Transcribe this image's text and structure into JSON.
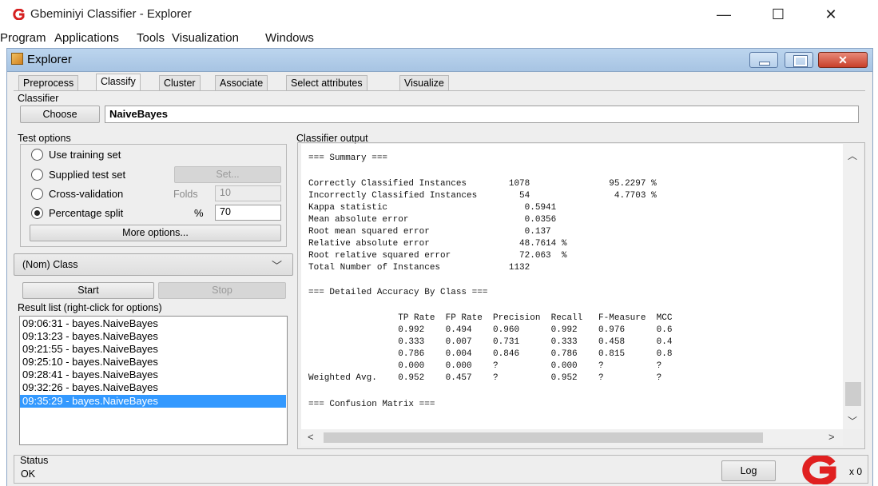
{
  "window": {
    "title": "Gbeminiyi Classifier - Explorer",
    "controls": {
      "minimize": "—",
      "maximize": "☐",
      "close": "✕"
    }
  },
  "menu": [
    "Program",
    "Applications",
    "Tools",
    "Visualization",
    "Windows"
  ],
  "inner": {
    "title": "Explorer"
  },
  "tabs": [
    "Preprocess",
    "Classify",
    "Cluster",
    "Associate",
    "Select attributes",
    "Visualize"
  ],
  "active_tab": "Classify",
  "classifier": {
    "group_label": "Classifier",
    "choose_label": "Choose",
    "value": "NaiveBayes"
  },
  "test_options": {
    "group_label": "Test options",
    "use_training": "Use training set",
    "supplied_test": "Supplied test set",
    "set_button": "Set...",
    "cross_validation": "Cross-validation",
    "folds_label": "Folds",
    "folds_value": "10",
    "percentage_split": "Percentage split",
    "percent_symbol": "%",
    "percent_value": "70",
    "selected": "Percentage split",
    "more_options": "More options..."
  },
  "class_select": {
    "value": "(Nom) Class"
  },
  "actions": {
    "start": "Start",
    "stop": "Stop"
  },
  "result_list": {
    "label": "Result list (right-click for options)",
    "items": [
      "09:06:31 - bayes.NaiveBayes",
      "09:13:23 - bayes.NaiveBayes",
      "09:21:55 - bayes.NaiveBayes",
      "09:25:10 - bayes.NaiveBayes",
      "09:28:41 - bayes.NaiveBayes",
      "09:32:26 - bayes.NaiveBayes",
      "09:35:29 - bayes.NaiveBayes"
    ],
    "selected_index": 6
  },
  "output": {
    "label": "Classifier output",
    "lines": [
      "=== Summary ===",
      "",
      "Correctly Classified Instances        1078               95.2297 %",
      "Incorrectly Classified Instances        54                4.7703 %",
      "Kappa statistic                          0.5941",
      "Mean absolute error                      0.0356",
      "Root mean squared error                  0.137",
      "Relative absolute error                 48.7614 %",
      "Root relative squared error             72.063  %",
      "Total Number of Instances             1132",
      "",
      "=== Detailed Accuracy By Class ===",
      "",
      "                 TP Rate  FP Rate  Precision  Recall   F-Measure  MCC",
      "                 0.992    0.494    0.960      0.992    0.976      0.6",
      "                 0.333    0.007    0.731      0.333    0.458      0.4",
      "                 0.786    0.004    0.846      0.786    0.815      0.8",
      "                 0.000    0.000    ?          0.000    ?          ?",
      "Weighted Avg.    0.952    0.457    ?          0.952    ?          ?",
      "",
      "=== Confusion Matrix ==="
    ]
  },
  "status": {
    "label": "Status",
    "text": "OK",
    "log_button": "Log",
    "count": "x 0"
  },
  "colors": {
    "selection": "#3399ff",
    "logo": "#e02020",
    "title_gradient": "#a7c4e3"
  }
}
